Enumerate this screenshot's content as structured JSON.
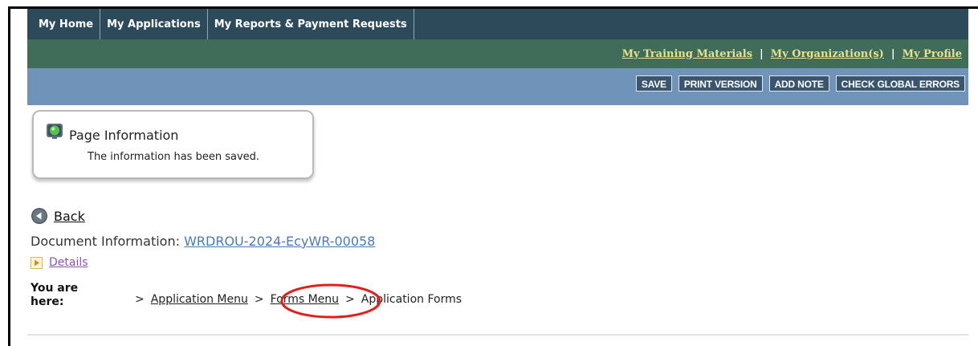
{
  "nav_top": {
    "items": [
      "My Home",
      "My Applications",
      "My Reports & Payment Requests"
    ]
  },
  "nav_secondary": {
    "items": [
      "My Training Materials",
      "My Organization(s)",
      "My Profile"
    ],
    "separator": "|"
  },
  "toolbar": {
    "buttons": [
      "SAVE",
      "PRINT VERSION",
      "ADD NOTE",
      "CHECK GLOBAL ERRORS"
    ]
  },
  "page_info": {
    "title": "Page Information",
    "message": "The information has been saved."
  },
  "back": {
    "label": "Back"
  },
  "document": {
    "label": "Document Information:",
    "id": "WRDROU-2024-EcyWR-00058"
  },
  "details": {
    "label": "Details"
  },
  "breadcrumb": {
    "prefix": "You are here:",
    "separator": ">",
    "items": [
      "Application Menu",
      "Forms Menu",
      "Application Forms"
    ]
  },
  "colors": {
    "nav_top_bg": "#2d4a5a",
    "nav_secondary_bg": "#3f6d5a",
    "toolbar_bg": "#6f93b9",
    "button_bg": "#3a556e",
    "secondary_link": "#e9e08a",
    "doc_link": "#4a7ab5",
    "details_link": "#8a55b0",
    "highlight": "#e0201b"
  },
  "icons": {
    "page_info": "green-status-icon",
    "back": "back-arrow-icon",
    "details": "expand-arrow-icon"
  }
}
